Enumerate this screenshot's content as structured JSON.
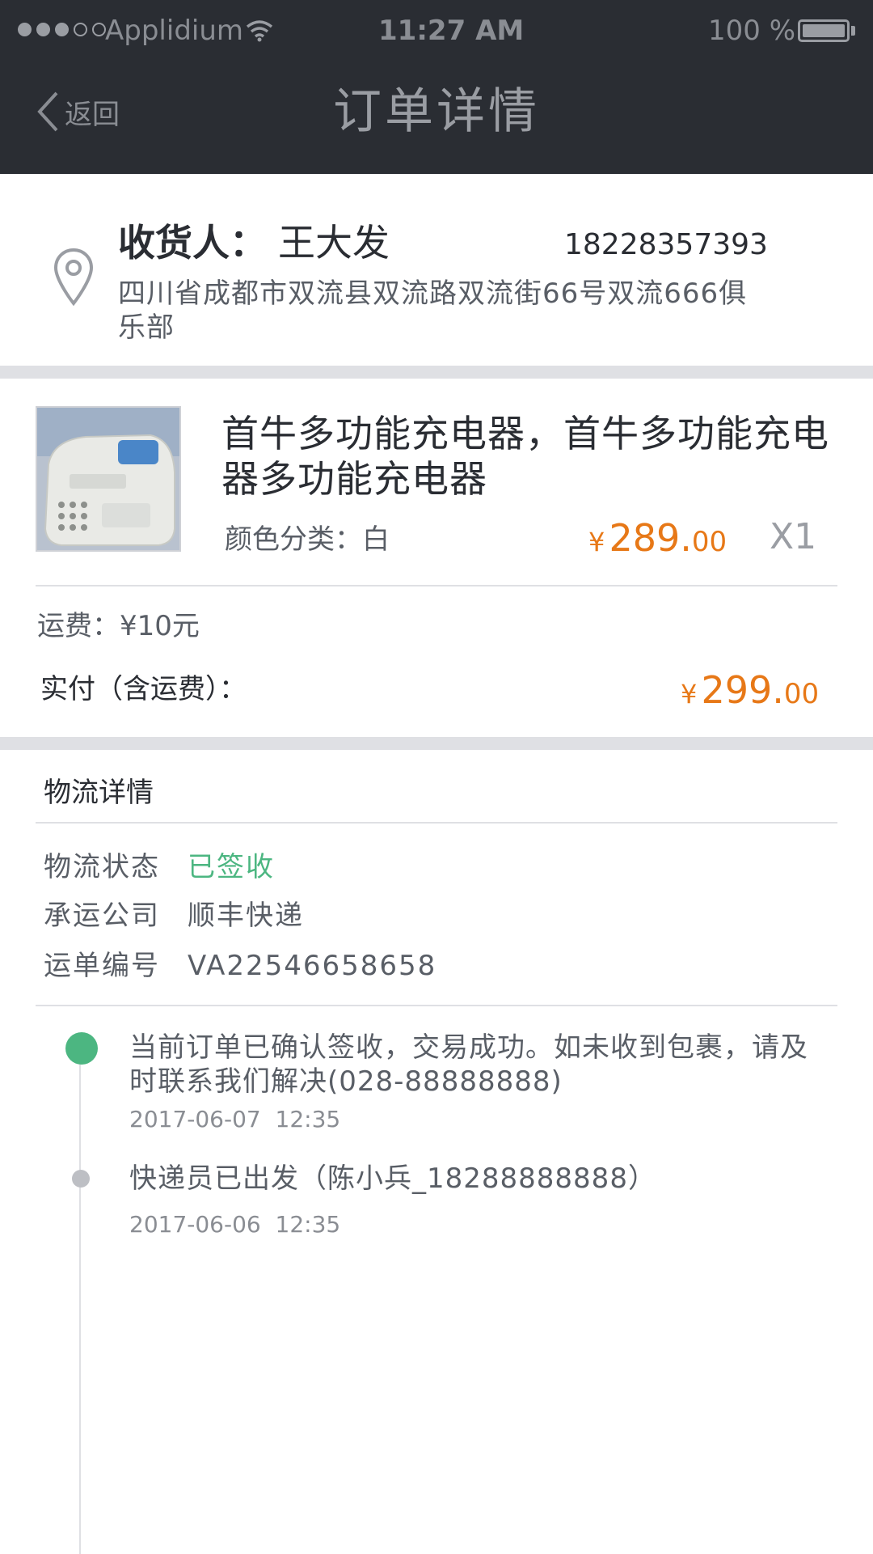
{
  "status_bar": {
    "carrier": "Applidium",
    "time": "11:27 AM",
    "battery": "100 %"
  },
  "nav": {
    "back_label": "返回",
    "title": "订单详情"
  },
  "receiver": {
    "label": "收货人：",
    "name": "王大发",
    "phone": "18228357393",
    "address": "四川省成都市双流县双流路双流街66号双流666俱乐部"
  },
  "product": {
    "name": "首牛多功能充电器，首牛多功能充电器多功能充电器",
    "spec": "颜色分类：白",
    "price_symbol": "¥",
    "price_int": "289.",
    "price_dec": "00",
    "quantity": "X1"
  },
  "fees": {
    "freight": "运费：¥10元",
    "paid_label": "实付（含运费）：",
    "paid_symbol": "¥",
    "paid_int": "299.",
    "paid_dec": "00"
  },
  "logistics": {
    "title": "物流详情",
    "status_label": "物流状态",
    "status_value": "已签收",
    "carrier_label": "承运公司",
    "carrier_value": "顺丰快递",
    "tracking_label": "运单编号",
    "tracking_value": "VA22546658658"
  },
  "timeline": [
    {
      "text": "当前订单已确认签收，交易成功。如未收到包裹，请及时联系我们解决(028-88888888)",
      "time": "2017-06-07  12:35"
    },
    {
      "text": "快递员已出发（陈小兵_18288888888）",
      "time": "2017-06-06  12:35"
    }
  ],
  "colors": {
    "nav_background": "#2A2D33",
    "text_primary": "#2A2D33",
    "text_secondary": "#595E66",
    "price": "#E77817",
    "success": "#4CB681"
  }
}
